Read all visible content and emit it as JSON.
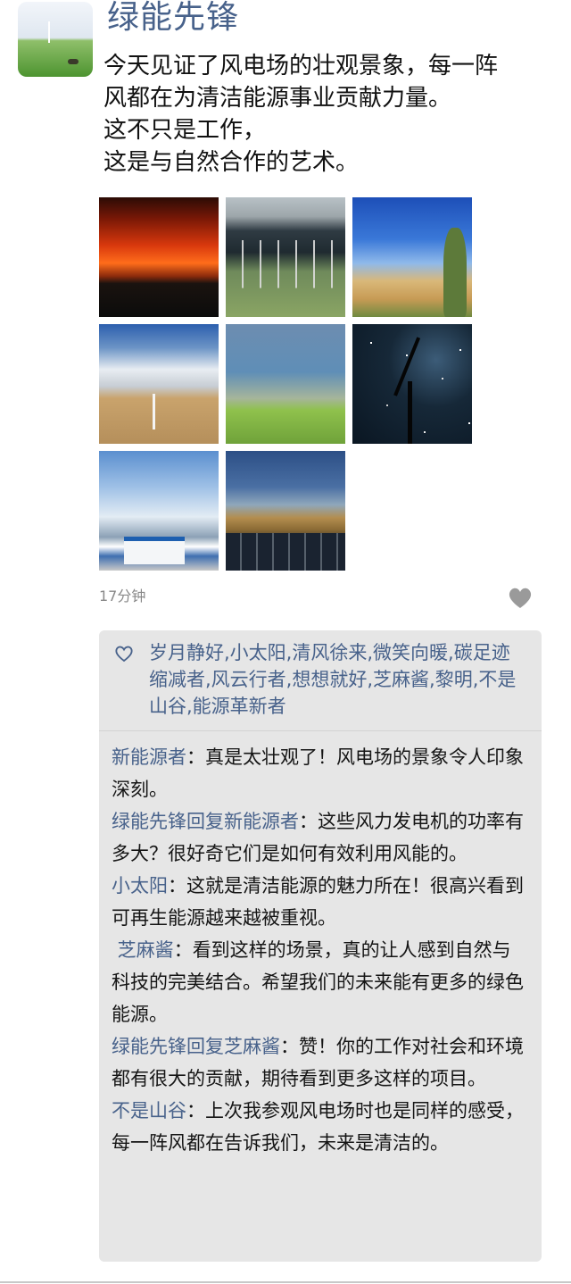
{
  "post": {
    "author": "绿能先锋",
    "content_lines": [
      "今天见证了风电场的壮观景象，每一阵",
      "风都在为清洁能源事业贡献力量。",
      "这不只是工作，",
      "这是与自然合作的艺术。"
    ],
    "time": "17分钟"
  },
  "likes": {
    "names": "岁月静好,小太阳,清风徐来,微笑向暖,碳足迹缩减者,风云行者,想想就好,芝麻酱,黎明,不是山谷,能源革新者"
  },
  "comments": [
    {
      "name": "新能源者",
      "separator": "：",
      "text": "真是太壮观了！风电场的景象令人印象深刻。"
    },
    {
      "name": "绿能先锋回复新能源者",
      "separator": "：",
      "text": "这些风力发电机的功率有多大？很好奇它们是如何有效利用风能的。"
    },
    {
      "name": "小太阳",
      "separator": "：",
      "text": "这就是清洁能源的魅力所在！很高兴看到可再生能源越来越被重视。"
    },
    {
      "name": " 芝麻酱",
      "separator": "：",
      "text": "看到这样的场景，真的让人感到自然与科技的完美结合。希望我们的未来能有更多的绿色能源。"
    },
    {
      "name": "绿能先锋回复芝麻酱",
      "separator": "：",
      "text": "赞！你的工作对社会和环境都有很大的贡献，期待看到更多这样的项目。"
    },
    {
      "name": "不是山谷",
      "separator": "：",
      "text": "上次我参观风电场时也是同样的感受，每一阵风都在告诉我们，未来是清洁的。"
    }
  ],
  "colors": {
    "name_blue": "#48628b",
    "panel_bg": "#e6e6e6"
  },
  "icons": {
    "like": "heart-outline-icon",
    "menu": "heart-filled-icon"
  }
}
